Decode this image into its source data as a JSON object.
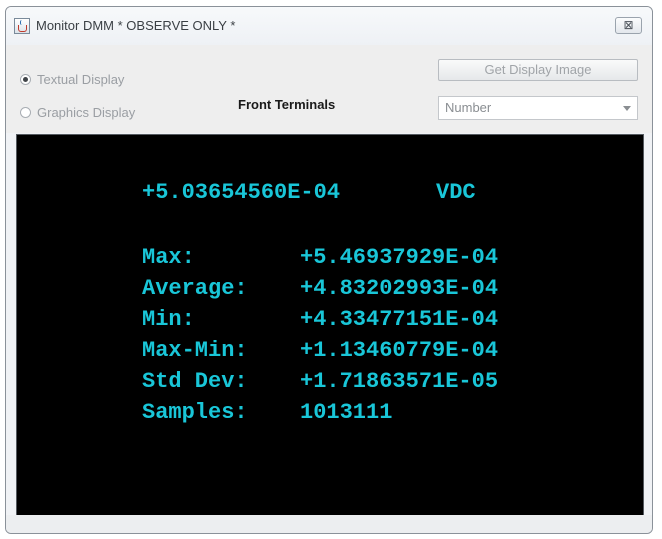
{
  "window": {
    "title": "Monitor DMM * OBSERVE ONLY *",
    "close_label": "⊠"
  },
  "controls": {
    "display_mode": {
      "options": [
        "Textual Display",
        "Graphics Display"
      ],
      "selected": "Textual Display"
    },
    "terminals": "Front Terminals",
    "get_image_label": "Get Display Image",
    "format_select": {
      "selected": "Number"
    }
  },
  "display": {
    "reading": "+5.03654560E-04",
    "unit": "VDC",
    "stats": [
      {
        "label": "Max:",
        "value": "+5.46937929E-04"
      },
      {
        "label": "Average:",
        "value": "+4.83202993E-04"
      },
      {
        "label": "Min:",
        "value": "+4.33477151E-04"
      },
      {
        "label": "Max-Min:",
        "value": "+1.13460779E-04"
      },
      {
        "label": "Std Dev:",
        "value": "+1.71863571E-05"
      },
      {
        "label": "Samples:",
        "value": "1013111"
      }
    ],
    "text_color": "#19c6d8",
    "background_color": "#000000"
  }
}
